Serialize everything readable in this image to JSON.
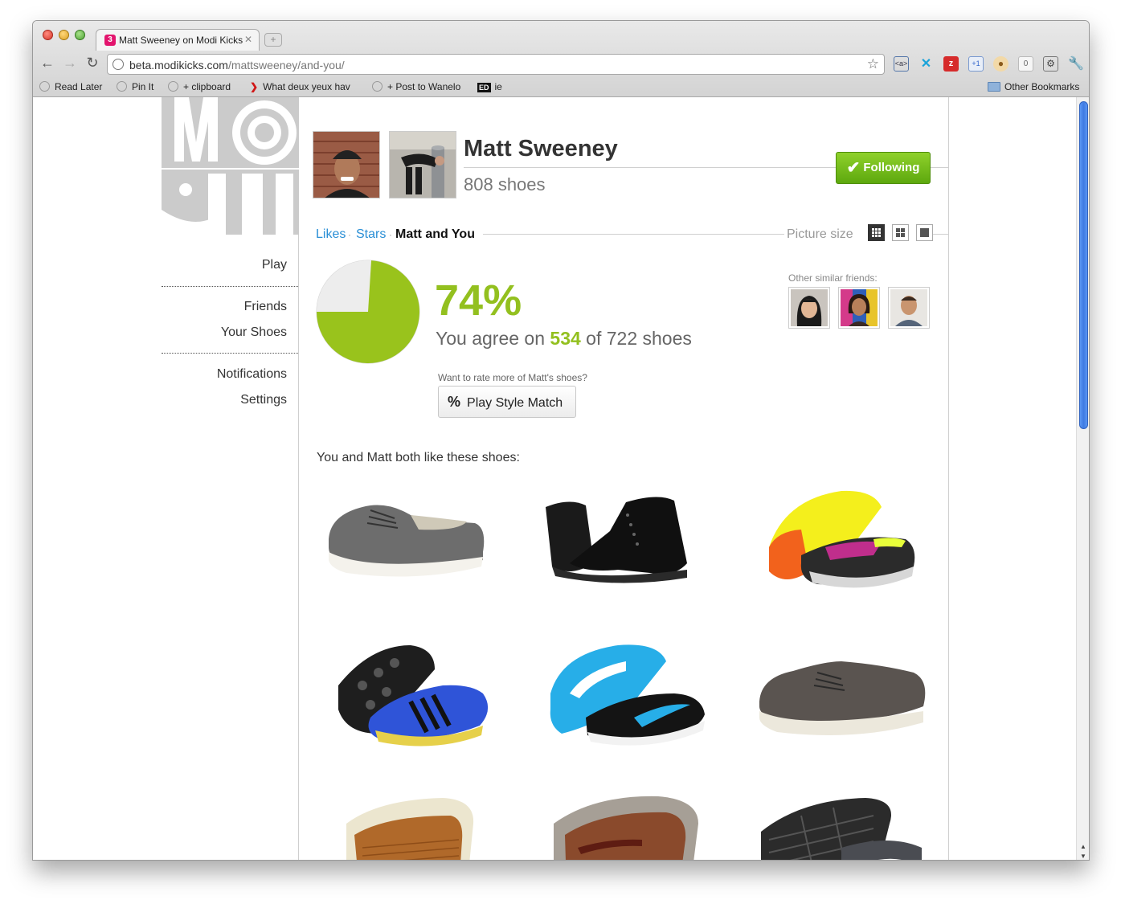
{
  "browser": {
    "tab_title": "Matt Sweeney on Modi Kicks",
    "tab_favicon_letter": "3",
    "url_host": "beta.modikicks.com",
    "url_path": "/mattsweeney/and-you/",
    "ext_zero_count": "0",
    "bookmarks": [
      "Read Later",
      "Pin It",
      "+ clipboard",
      "What deux yeux hav",
      "+ Post to Wanelo",
      "ie"
    ],
    "bookmark_ed_badge": "ED",
    "other_bookmarks": "Other Bookmarks"
  },
  "sidebar": {
    "items": [
      "Play",
      "Friends",
      "Your Shoes",
      "Notifications",
      "Settings"
    ]
  },
  "profile": {
    "name": "Matt Sweeney",
    "shoe_count": "808 shoes",
    "follow_label": "Following"
  },
  "subtabs": {
    "items": [
      "Likes",
      "Stars",
      "Matt and You"
    ],
    "active": "Matt and You",
    "picture_size_label": "Picture size"
  },
  "match": {
    "percent": "74%",
    "agree_prefix": "You agree on ",
    "agree_count": "534",
    "agree_suffix": " of 722 shoes",
    "want_more": "Want to rate more of Matt's shoes?",
    "play_label": "Play Style Match",
    "play_icon": "%"
  },
  "similar": {
    "label": "Other similar friends:"
  },
  "both_like": {
    "label": "You and Matt both like these shoes:"
  },
  "chart_data": {
    "type": "pie",
    "values": [
      74,
      26
    ],
    "colors": [
      "#99c31c",
      "#ededed"
    ]
  },
  "colors": {
    "accent_green": "#93c01f",
    "link_blue": "#2a8fd6",
    "follow_green": "#6cb817"
  }
}
